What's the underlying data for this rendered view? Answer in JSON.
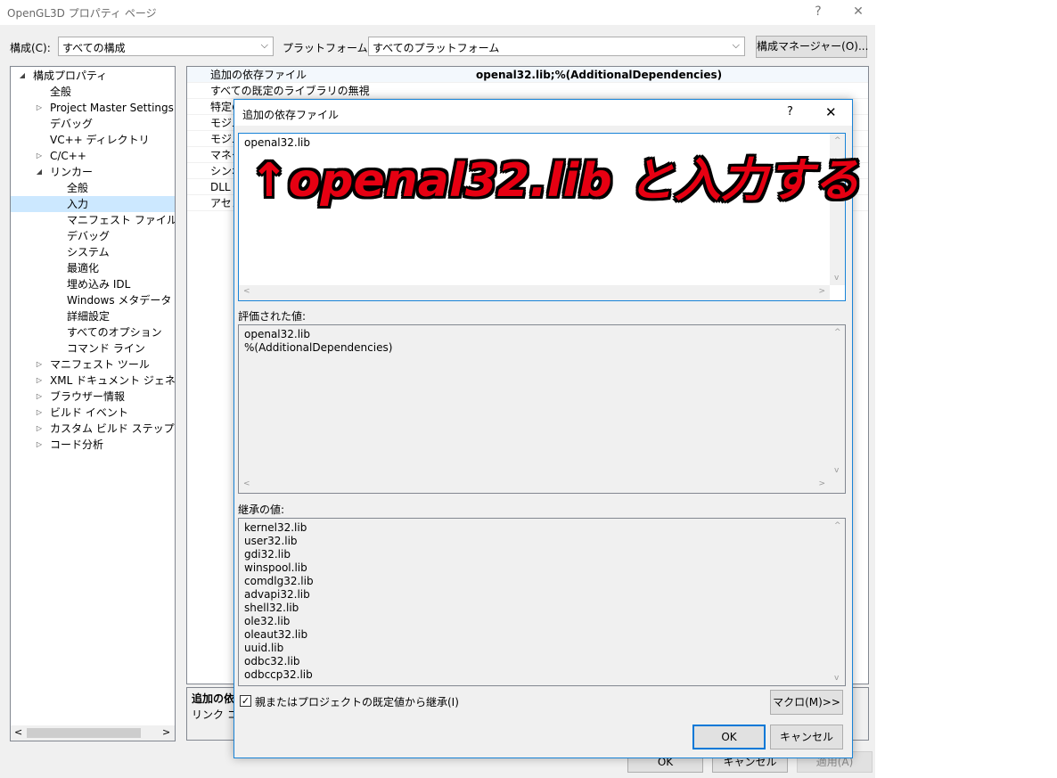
{
  "window": {
    "title": "OpenGL3D プロパティ ページ",
    "help": "?",
    "close": "✕"
  },
  "toolbar": {
    "config_label": "構成(C):",
    "config_value": "すべての構成",
    "platform_label": "プラットフォーム(P):",
    "platform_value": "すべてのプラットフォーム",
    "config_manager": "構成マネージャー(O)..."
  },
  "tree": {
    "items": [
      {
        "label": "構成プロパティ",
        "expander": "◢"
      },
      {
        "label": "全般",
        "expander": ""
      },
      {
        "label": "Project Master Settings",
        "expander": "▷"
      },
      {
        "label": "デバッグ",
        "expander": ""
      },
      {
        "label": "VC++ ディレクトリ",
        "expander": ""
      },
      {
        "label": "C/C++",
        "expander": "▷"
      },
      {
        "label": "リンカー",
        "expander": "◢"
      },
      {
        "label": "全般",
        "expander": ""
      },
      {
        "label": "入力",
        "expander": ""
      },
      {
        "label": "マニフェスト ファイル",
        "expander": ""
      },
      {
        "label": "デバッグ",
        "expander": ""
      },
      {
        "label": "システム",
        "expander": ""
      },
      {
        "label": "最適化",
        "expander": ""
      },
      {
        "label": "埋め込み IDL",
        "expander": ""
      },
      {
        "label": "Windows メタデータ",
        "expander": ""
      },
      {
        "label": "詳細設定",
        "expander": ""
      },
      {
        "label": "すべてのオプション",
        "expander": ""
      },
      {
        "label": "コマンド ライン",
        "expander": ""
      },
      {
        "label": "マニフェスト ツール",
        "expander": "▷"
      },
      {
        "label": "XML ドキュメント ジェネレーター",
        "expander": "▷"
      },
      {
        "label": "ブラウザー情報",
        "expander": "▷"
      },
      {
        "label": "ビルド イベント",
        "expander": "▷"
      },
      {
        "label": "カスタム ビルド ステップ",
        "expander": "▷"
      },
      {
        "label": "コード分析",
        "expander": "▷"
      }
    ],
    "scroll_left": "<",
    "scroll_right": ">"
  },
  "grid": {
    "rows": [
      {
        "name": "追加の依存ファイル",
        "value": "openal32.lib;%(AdditionalDependencies)"
      },
      {
        "name": "すべての既定のライブラリの無視",
        "value": ""
      },
      {
        "name": "特定の",
        "value": ""
      },
      {
        "name": "モジュ",
        "value": ""
      },
      {
        "name": "モジュ",
        "value": ""
      },
      {
        "name": "マネー",
        "value": ""
      },
      {
        "name": "シンボ",
        "value": ""
      },
      {
        "name": "DLL の",
        "value": ""
      },
      {
        "name": "アセン",
        "value": ""
      }
    ]
  },
  "description": {
    "title": "追加の依",
    "text": "リンク コマ"
  },
  "bottom_buttons": {
    "ok": "OK",
    "cancel": "キャンセル",
    "apply": "適用(A)"
  },
  "dialog": {
    "title": "追加の依存ファイル",
    "help": "?",
    "close": "✕",
    "input_lines": [
      "openal32.lib"
    ],
    "evaluated_label": "評価された値:",
    "evaluated_lines": [
      "openal32.lib",
      "%(AdditionalDependencies)"
    ],
    "inherited_label": "継承の値:",
    "inherited_lines": [
      "kernel32.lib",
      "user32.lib",
      "gdi32.lib",
      "winspool.lib",
      "comdlg32.lib",
      "advapi32.lib",
      "shell32.lib",
      "ole32.lib",
      "oleaut32.lib",
      "uuid.lib",
      "odbc32.lib",
      "odbccp32.lib"
    ],
    "inherit_checkbox_label": "親またはプロジェクトの既定値から継承(I)",
    "inherit_checked": "✓",
    "macro_button": "マクロ(M)>>",
    "ok": "OK",
    "cancel": "キャンセル"
  },
  "annotation": {
    "text": "↑openal32.lib と入力する",
    "color": "#e60012"
  },
  "scroll_glyphs": {
    "up": "^",
    "down": "v",
    "left": "<",
    "right": ">"
  }
}
